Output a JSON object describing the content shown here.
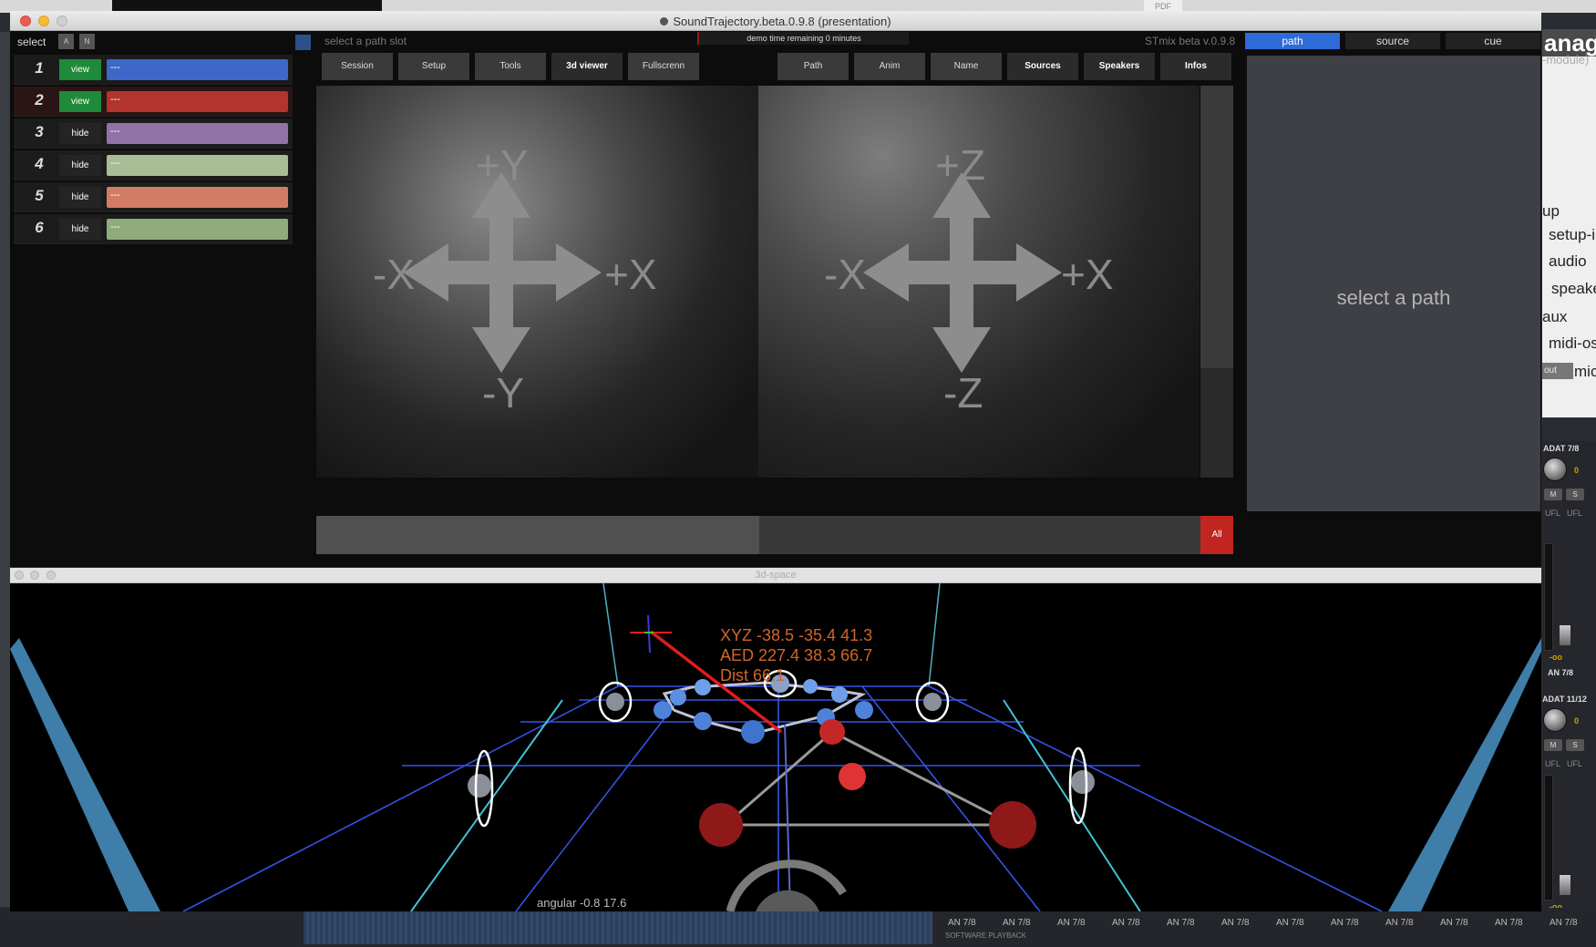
{
  "window": {
    "title": "SoundTrajectory.beta.0.9.8 (presentation)"
  },
  "header": {
    "select_label": "select",
    "btn_a": "A",
    "btn_n": "N",
    "hint": "select a path slot",
    "demo_text": "demo time remaining 0 minutes",
    "version": "STmix beta v.0.9.8"
  },
  "slots": [
    {
      "num": "1",
      "state": "view",
      "label": "---",
      "color": "#3f67c9",
      "state_color": "#1e8a3a"
    },
    {
      "num": "2",
      "state": "view",
      "label": "---",
      "color": "#b3342c",
      "state_color": "#1e8a3a"
    },
    {
      "num": "3",
      "state": "hide",
      "label": "---",
      "color": "#9272a6",
      "state_color": "#242424"
    },
    {
      "num": "4",
      "state": "hide",
      "label": "---",
      "color": "#a7bd95",
      "state_color": "#242424"
    },
    {
      "num": "5",
      "state": "hide",
      "label": "---",
      "color": "#d27c66",
      "state_color": "#242424"
    },
    {
      "num": "6",
      "state": "hide",
      "label": "---",
      "color": "#90ab7c",
      "state_color": "#242424"
    }
  ],
  "tabs_left": [
    "Session",
    "Setup",
    "Tools",
    "3d viewer",
    "Fullscrenn"
  ],
  "tabs_right": [
    "Path",
    "Anim",
    "Name",
    "Sources",
    "Speakers",
    "Infos"
  ],
  "right_tabs": [
    "path",
    "source",
    "cue"
  ],
  "right_panel_text": "select a path",
  "viewer_left": {
    "up": "+Y",
    "down": "-Y",
    "left": "-X",
    "right": "+X"
  },
  "viewer_right": {
    "up": "+Z",
    "down": "-Z",
    "left": "-X",
    "right": "+X"
  },
  "all_button": "All",
  "space3d": {
    "title": "3d-space",
    "xyz": "XYZ -38.5 -35.4 41.3",
    "aed": "AED 227.4 38.3 66.7",
    "dist": "Dist 66.1",
    "angular": "angular -0.8 17.6"
  },
  "background_app": {
    "pdf": "PDF",
    "manage": "anage",
    "module": "-module)",
    "list": [
      "up",
      "setup-i",
      "audio",
      "speake",
      "aux",
      "midi-os",
      "mic"
    ],
    "out_label": "out",
    "channel1": "ADAT 7/8",
    "channel2": "ADAT 11/12",
    "m": "M",
    "s": "S",
    "ufl": "UFL",
    "zero": "0",
    "minus_inf": "-oo",
    "an_label": "AN 7/8",
    "software_playback": "SOFTWARE PLAYBACK"
  }
}
